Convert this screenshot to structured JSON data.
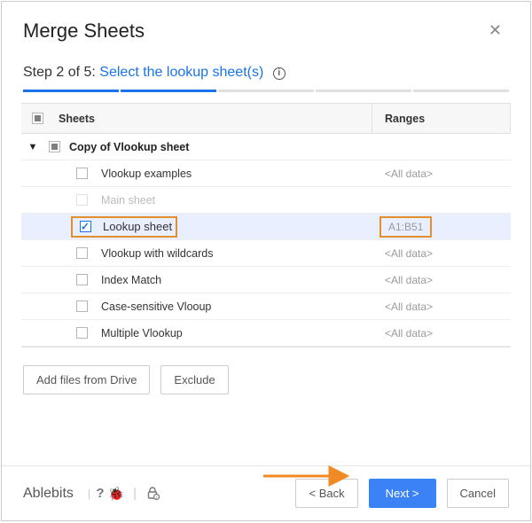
{
  "dialog": {
    "title": "Merge Sheets",
    "step_prefix": "Step 2 of 5:",
    "step_title": "Select the lookup sheet(s)",
    "progress_total": 5,
    "progress_done": 2
  },
  "table": {
    "header_sheets": "Sheets",
    "header_ranges": "Ranges",
    "group_name": "Copy of Vlookup sheet",
    "rows": [
      {
        "name": "Vlookup examples",
        "range": "<All data>",
        "checked": false,
        "disabled": false
      },
      {
        "name": "Main sheet",
        "range": "",
        "checked": false,
        "disabled": true
      },
      {
        "name": "Lookup sheet",
        "range": "A1:B51",
        "checked": true,
        "disabled": false,
        "selected": true,
        "highlighted": true
      },
      {
        "name": "Vlookup with wildcards",
        "range": "<All data>",
        "checked": false,
        "disabled": false
      },
      {
        "name": "Index Match",
        "range": "<All data>",
        "checked": false,
        "disabled": false
      },
      {
        "name": "Case-sensitive Vlooup",
        "range": "<All data>",
        "checked": false,
        "disabled": false
      },
      {
        "name": "Multiple Vlookup",
        "range": "<All data>",
        "checked": false,
        "disabled": false
      }
    ]
  },
  "buttons": {
    "add_files": "Add files from Drive",
    "exclude": "Exclude",
    "back": "< Back",
    "next": "Next >",
    "cancel": "Cancel"
  },
  "footer": {
    "brand": "Ablebits"
  }
}
